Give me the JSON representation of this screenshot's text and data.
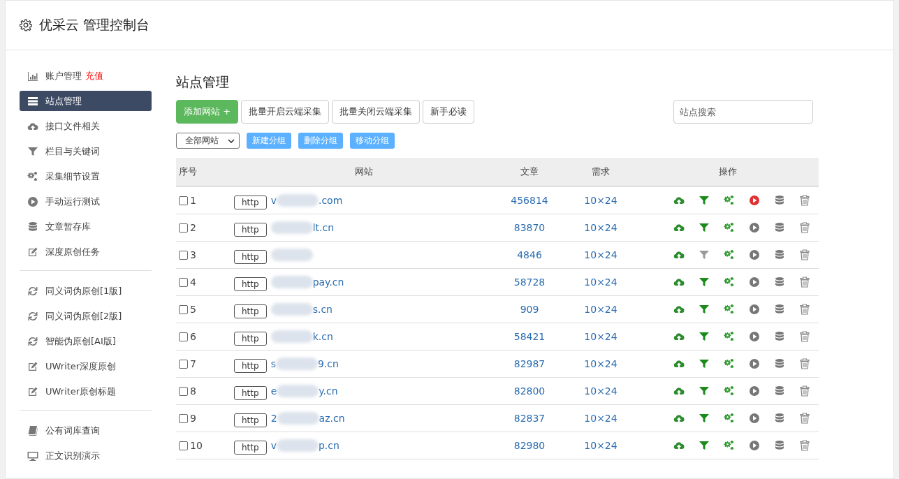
{
  "header": {
    "title": "优采云 管理控制台"
  },
  "sidebar": {
    "groups": [
      {
        "items": [
          {
            "kind": "chart",
            "label": "账户管理",
            "badge": "充值",
            "selected": false
          },
          {
            "kind": "list",
            "label": "站点管理",
            "selected": true
          },
          {
            "kind": "cloud",
            "label": "接口文件相关",
            "selected": false
          },
          {
            "kind": "filter",
            "label": "栏目与关键词",
            "selected": false
          },
          {
            "kind": "gears",
            "label": "采集细节设置",
            "selected": false
          },
          {
            "kind": "play",
            "label": "手动运行测试",
            "selected": false
          },
          {
            "kind": "database",
            "label": "文章暂存库",
            "selected": false
          },
          {
            "kind": "edit",
            "label": "深度原创任务",
            "selected": false
          }
        ]
      },
      {
        "items": [
          {
            "kind": "refresh",
            "label": "同义词伪原创[1版]",
            "selected": false
          },
          {
            "kind": "refresh",
            "label": "同义词伪原创[2版]",
            "selected": false
          },
          {
            "kind": "refresh",
            "label": "智能伪原创[AI版]",
            "selected": false
          },
          {
            "kind": "edit",
            "label": "UWriter深度原创",
            "selected": false
          },
          {
            "kind": "edit",
            "label": "UWriter原创标题",
            "selected": false
          }
        ]
      },
      {
        "items": [
          {
            "kind": "book",
            "label": "公有词库查询",
            "selected": false
          },
          {
            "kind": "monitor",
            "label": "正文识别演示",
            "selected": false
          }
        ]
      }
    ]
  },
  "main": {
    "title": "站点管理",
    "toolbar": [
      {
        "kind": "primary",
        "label": "添加网站 +"
      },
      {
        "kind": "default",
        "label": "批量开启云端采集"
      },
      {
        "kind": "default",
        "label": "批量关闭云端采集"
      },
      {
        "kind": "default",
        "label": "新手必读"
      }
    ],
    "search": {
      "placeholder": "站点搜索"
    },
    "group_select": {
      "value": "全部网站"
    },
    "group_buttons": [
      "新建分组",
      "删除分组",
      "移动分组"
    ],
    "table": {
      "columns": [
        "序号",
        "网站",
        "文章",
        "需求",
        "操作"
      ],
      "rows": [
        {
          "index": "1",
          "checked": false,
          "scheme": "http",
          "domain_start": "v",
          "domain_end": ".com",
          "articles": "456814",
          "demand": "10×24",
          "filter_on": true,
          "running": true
        },
        {
          "index": "2",
          "checked": false,
          "scheme": "http",
          "domain_end": "lt.cn",
          "articles": "83870",
          "demand": "10×24",
          "filter_on": true,
          "running": false
        },
        {
          "index": "3",
          "checked": false,
          "scheme": "http",
          "articles": "4846",
          "demand": "10×24",
          "filter_on": false,
          "running": false
        },
        {
          "index": "4",
          "checked": false,
          "scheme": "http",
          "domain_end": "pay.cn",
          "articles": "58728",
          "demand": "10×24",
          "filter_on": true,
          "running": false
        },
        {
          "index": "5",
          "checked": false,
          "scheme": "http",
          "domain_end": "s.cn",
          "articles": "909",
          "demand": "10×24",
          "filter_on": true,
          "running": false
        },
        {
          "index": "6",
          "checked": false,
          "scheme": "http",
          "domain_end": "k.cn",
          "articles": "58421",
          "demand": "10×24",
          "filter_on": true,
          "running": false
        },
        {
          "index": "7",
          "checked": false,
          "scheme": "http",
          "domain_start": "s",
          "domain_end": "9.cn",
          "articles": "82987",
          "demand": "10×24",
          "filter_on": true,
          "running": false
        },
        {
          "index": "8",
          "checked": false,
          "scheme": "http",
          "domain_start": "e",
          "domain_end": "y.cn",
          "articles": "82800",
          "demand": "10×24",
          "filter_on": true,
          "running": false
        },
        {
          "index": "9",
          "checked": false,
          "scheme": "http",
          "domain_start": "2",
          "domain_end": "az.cn",
          "articles": "82837",
          "demand": "10×24",
          "filter_on": true,
          "running": false
        },
        {
          "index": "10",
          "checked": false,
          "scheme": "http",
          "domain_start": "v",
          "domain_end": "p.cn",
          "articles": "82980",
          "demand": "10×24",
          "filter_on": true,
          "running": false
        }
      ]
    }
  }
}
